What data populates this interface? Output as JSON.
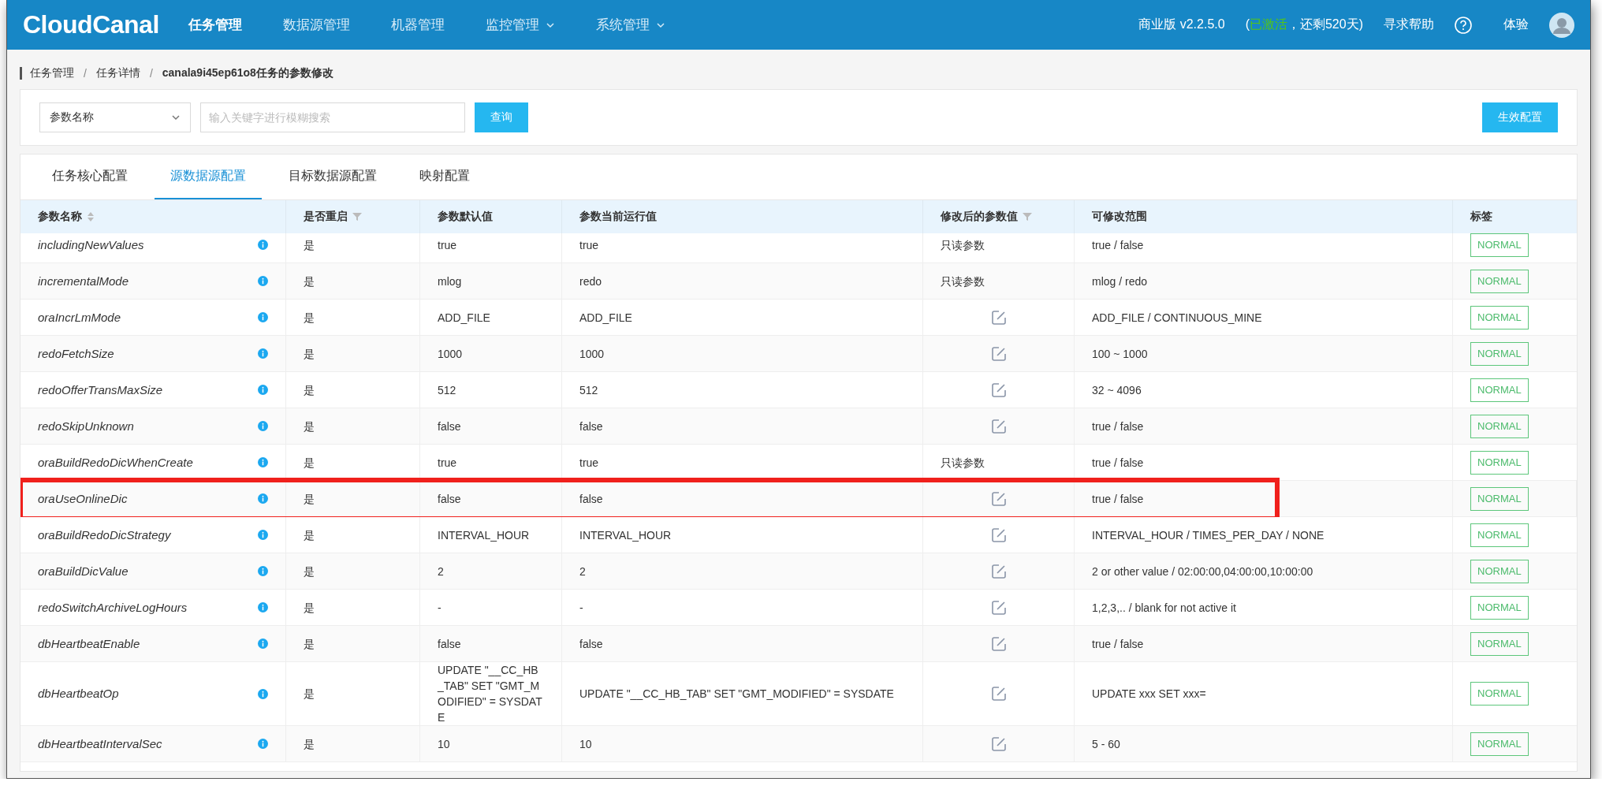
{
  "nav": {
    "logo": "CloudCanal",
    "items": [
      {
        "label": "任务管理",
        "selected": true,
        "dropdown": false
      },
      {
        "label": "数据源管理",
        "selected": false,
        "dropdown": false
      },
      {
        "label": "机器管理",
        "selected": false,
        "dropdown": false
      },
      {
        "label": "监控管理",
        "selected": false,
        "dropdown": true
      },
      {
        "label": "系统管理",
        "selected": false,
        "dropdown": true
      }
    ],
    "edition": "商业版 v2.2.5.0",
    "license_open": "(",
    "license_status": "已激活",
    "license_rest": "，还剩520天)",
    "help": "寻求帮助",
    "user": "体验"
  },
  "breadcrumb": {
    "separator": "/",
    "items": [
      {
        "label": "任务管理",
        "current": false
      },
      {
        "label": "任务详情",
        "current": false
      },
      {
        "label": "canala9i45ep61o8任务的参数修改",
        "current": true
      }
    ]
  },
  "search": {
    "field_select": "参数名称",
    "placeholder": "输入关键字进行模糊搜索",
    "query_button": "查询",
    "apply_button": "生效配置"
  },
  "tabs": [
    {
      "label": "任务核心配置",
      "selected": false
    },
    {
      "label": "源数据源配置",
      "selected": true
    },
    {
      "label": "目标数据源配置",
      "selected": false
    },
    {
      "label": "映射配置",
      "selected": false
    }
  ],
  "table": {
    "columns": [
      {
        "label": "参数名称",
        "sortable": true,
        "filterable": false
      },
      {
        "label": "是否重启",
        "sortable": false,
        "filterable": true
      },
      {
        "label": "参数默认值",
        "sortable": false,
        "filterable": false
      },
      {
        "label": "参数当前运行值",
        "sortable": false,
        "filterable": false
      },
      {
        "label": "修改后的参数值",
        "sortable": false,
        "filterable": true
      },
      {
        "label": "可修改范围",
        "sortable": false,
        "filterable": false
      },
      {
        "label": "标签",
        "sortable": false,
        "filterable": false
      }
    ],
    "rows": [
      {
        "name": "includingNewValues",
        "restart": "是",
        "default": "true",
        "current": "true",
        "editable": false,
        "modified_text": "只读参数",
        "range": "true / false",
        "tag": "NORMAL",
        "highlighted": false
      },
      {
        "name": "incrementalMode",
        "restart": "是",
        "default": "mlog",
        "current": "redo",
        "editable": false,
        "modified_text": "只读参数",
        "range": "mlog / redo",
        "tag": "NORMAL",
        "highlighted": false
      },
      {
        "name": "oraIncrLmMode",
        "restart": "是",
        "default": "ADD_FILE",
        "current": "ADD_FILE",
        "editable": true,
        "range": "ADD_FILE / CONTINUOUS_MINE",
        "tag": "NORMAL",
        "highlighted": false
      },
      {
        "name": "redoFetchSize",
        "restart": "是",
        "default": "1000",
        "current": "1000",
        "editable": true,
        "range": "100 ~ 1000",
        "tag": "NORMAL",
        "highlighted": false
      },
      {
        "name": "redoOfferTransMaxSize",
        "restart": "是",
        "default": "512",
        "current": "512",
        "editable": true,
        "range": "32 ~ 4096",
        "tag": "NORMAL",
        "highlighted": false
      },
      {
        "name": "redoSkipUnknown",
        "restart": "是",
        "default": "false",
        "current": "false",
        "editable": true,
        "range": "true / false",
        "tag": "NORMAL",
        "highlighted": false
      },
      {
        "name": "oraBuildRedoDicWhenCreate",
        "restart": "是",
        "default": "true",
        "current": "true",
        "editable": false,
        "modified_text": "只读参数",
        "range": "true / false",
        "tag": "NORMAL",
        "highlighted": false
      },
      {
        "name": "oraUseOnlineDic",
        "restart": "是",
        "default": "false",
        "current": "false",
        "editable": true,
        "range": "true / false",
        "tag": "NORMAL",
        "highlighted": true
      },
      {
        "name": "oraBuildRedoDicStrategy",
        "restart": "是",
        "default": "INTERVAL_HOUR",
        "current": "INTERVAL_HOUR",
        "editable": true,
        "range": "INTERVAL_HOUR / TIMES_PER_DAY / NONE",
        "tag": "NORMAL",
        "highlighted": false
      },
      {
        "name": "oraBuildDicValue",
        "restart": "是",
        "default": "2",
        "current": "2",
        "editable": true,
        "range": "2 or other value / 02:00:00,04:00:00,10:00:00",
        "tag": "NORMAL",
        "highlighted": false
      },
      {
        "name": "redoSwitchArchiveLogHours",
        "restart": "是",
        "default": "-",
        "current": "-",
        "editable": true,
        "range": "1,2,3,.. / blank for not active it",
        "tag": "NORMAL",
        "highlighted": false
      },
      {
        "name": "dbHeartbeatEnable",
        "restart": "是",
        "default": "false",
        "current": "false",
        "editable": true,
        "range": "true / false",
        "tag": "NORMAL",
        "highlighted": false
      },
      {
        "name": "dbHeartbeatOp",
        "restart": "是",
        "default": "UPDATE \"__CC_HB_TAB\" SET \"GMT_MODIFIED\" = SYSDATE",
        "current": "UPDATE \"__CC_HB_TAB\" SET \"GMT_MODIFIED\" = SYSDATE",
        "editable": true,
        "range": "UPDATE xxx SET xxx=",
        "tag": "NORMAL",
        "highlighted": false
      },
      {
        "name": "dbHeartbeatIntervalSec",
        "restart": "是",
        "default": "10",
        "current": "10",
        "editable": true,
        "range": "5 - 60",
        "tag": "NORMAL",
        "highlighted": false
      }
    ]
  }
}
